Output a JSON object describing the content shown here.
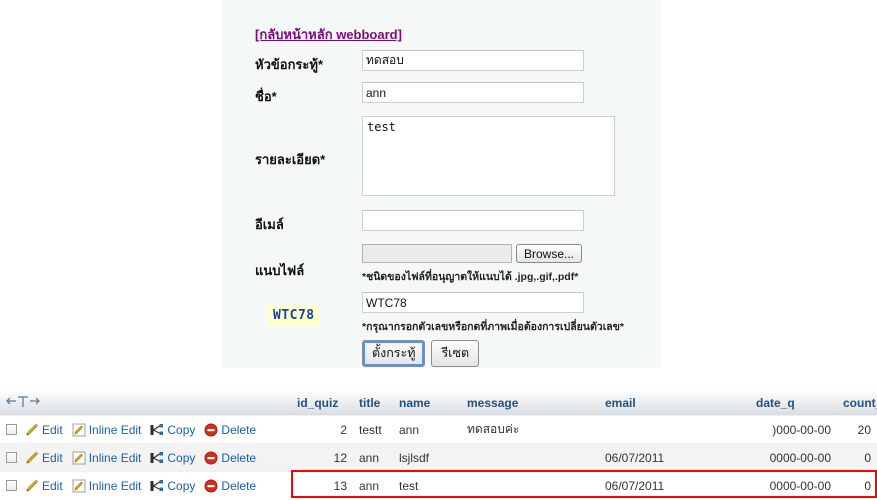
{
  "form": {
    "back_link": "[กลับหน้าหลัก webboard]",
    "fields": {
      "subject_label": "หัวข้อกระทู้*",
      "subject_value": "ทดสอบ",
      "name_label": "ชื่อ*",
      "name_value": "ann",
      "detail_label": "รายละเอียด*",
      "detail_value": "test",
      "email_label": "อีเมล์",
      "email_value": "",
      "attach_label": "แนบไฟล์",
      "file_value": "",
      "browse_label": "Browse...",
      "file_hint": "*ชนิดของไฟล์ที่อนุญาตให้แนบได้ .jpg,.gif,.pdf*",
      "captcha_image_text": "WTC78",
      "captcha_value": "WTC78",
      "captcha_hint": "*กรุณากรอกตัวเลขหรือกดที่ภาพเมื่อต้องการเปลี่ยนตัวเลข*",
      "submit_label": "ตั้งกระทู้",
      "reset_label": "รีเซต"
    },
    "colors": {
      "panel_bg": "#f4f8f7",
      "link": "#7b0b7b",
      "captcha_bg": "#ffffcc",
      "captcha_fg": "#1b3faa"
    }
  },
  "grid": {
    "action_labels": {
      "edit": "Edit",
      "inline_edit": "Inline Edit",
      "copy": "Copy",
      "delete": "Delete"
    },
    "icons": {
      "fulltext": "full-texts-arrows-icon",
      "edit": "pencil-icon",
      "inline_edit": "pencil-box-icon",
      "copy": "copy-icon",
      "delete": "delete-circle-icon",
      "checkbox": "row-checkbox"
    },
    "columns": [
      "id_quiz",
      "title",
      "name",
      "message",
      "email",
      "date_q",
      "count_q"
    ],
    "rows": [
      {
        "id_quiz": "2",
        "title": "testt",
        "name": "ann",
        "message": "ทดสอบค่ะ",
        "email": "",
        "date_q": ")000-00-00",
        "count_q": "20",
        "highlighted": false
      },
      {
        "id_quiz": "12",
        "title": "ann",
        "name": "lsjlsdf",
        "message": "",
        "email": "06/07/2011",
        "date_q": "0000-00-00",
        "count_q": "0",
        "highlighted": false
      },
      {
        "id_quiz": "13",
        "title": "ann",
        "name": "test",
        "message": "",
        "email": "06/07/2011",
        "date_q": "0000-00-00",
        "count_q": "0",
        "highlighted": true
      }
    ],
    "highlight_color": "#ff0000",
    "header_text_color": "#22527f",
    "link_color": "#1a5fb4"
  }
}
